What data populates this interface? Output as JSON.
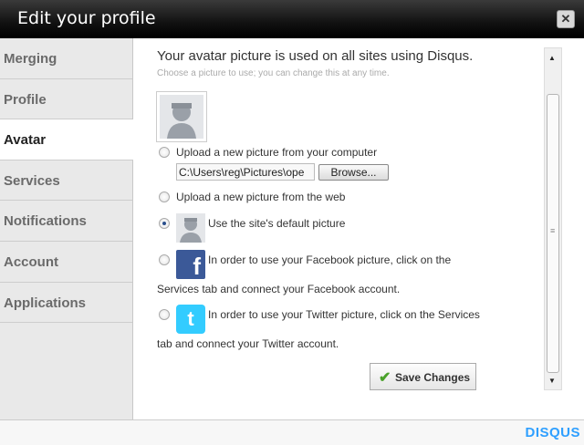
{
  "window": {
    "title": "Edit your profile",
    "close_icon": "close-icon"
  },
  "sidebar": {
    "items": [
      {
        "label": "Merging"
      },
      {
        "label": "Profile"
      },
      {
        "label": "Avatar",
        "active": true
      },
      {
        "label": "Services"
      },
      {
        "label": "Notifications"
      },
      {
        "label": "Account"
      },
      {
        "label": "Applications"
      }
    ]
  },
  "avatar": {
    "heading": "Your avatar picture is used on all sites using Disqus.",
    "subheading": "Choose a picture to use; you can change this at any time.",
    "options": {
      "upload_computer": {
        "label": "Upload a new picture from your computer",
        "checked": false
      },
      "file_path": "C:\\Users\\reg\\Pictures\\ope",
      "browse_label": "Browse...",
      "upload_web": {
        "label": "Upload a new picture from the web",
        "checked": false
      },
      "site_default": {
        "label": "Use the site's default picture",
        "checked": true
      },
      "facebook": {
        "line1": "In order to use your Facebook picture, click on the",
        "line2": "Services tab and connect your Facebook account.",
        "checked": false
      },
      "twitter": {
        "line1": "In order to use your Twitter picture, click on the Services",
        "line2": "tab and connect your Twitter account.",
        "checked": false
      }
    },
    "save_label": "Save Changes"
  },
  "footer": {
    "brand": "DISQUS"
  },
  "colors": {
    "brand": "#2e9fff",
    "facebook": "#3b5998",
    "twitter": "#33ccff",
    "titlebar": "#111111"
  }
}
